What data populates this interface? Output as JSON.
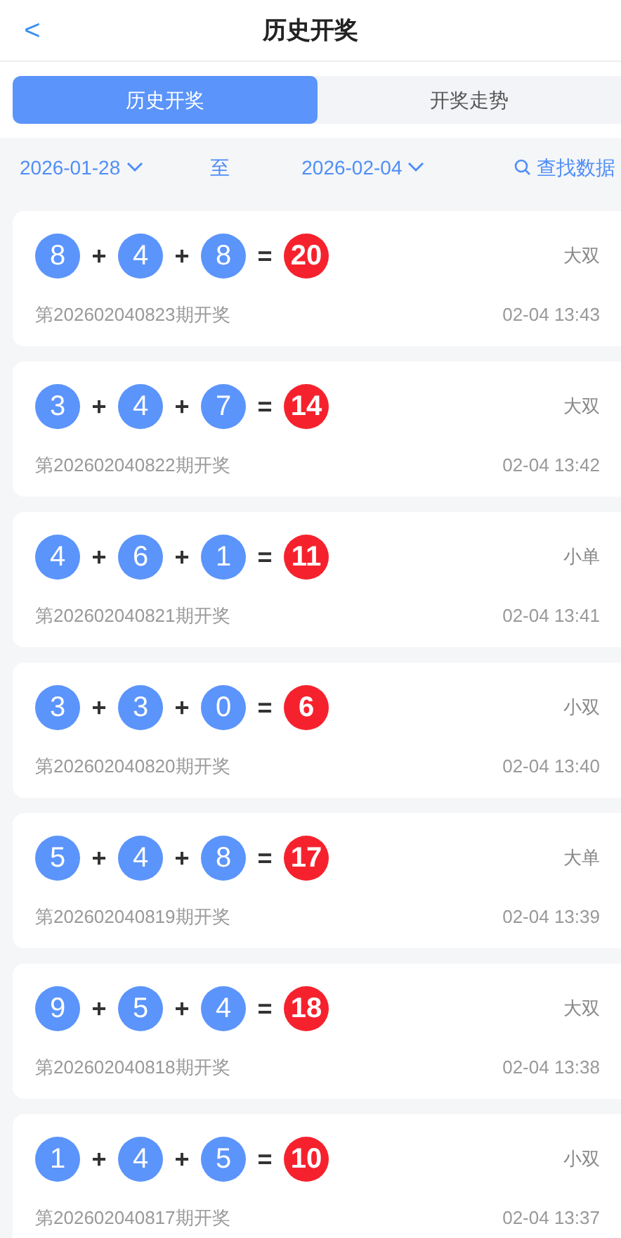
{
  "header": {
    "back": "<",
    "title": "历史开奖"
  },
  "tabs": [
    {
      "label": "历史开奖",
      "selected": true
    },
    {
      "label": "开奖走势",
      "selected": false
    }
  ],
  "filter": {
    "start_date": "2026-01-28",
    "separator": "至",
    "end_date": "2026-02-04",
    "search": "查找数据"
  },
  "records": [
    {
      "expression": [
        {
          "kind": "ball",
          "text": "8"
        },
        {
          "kind": "op",
          "text": "+"
        },
        {
          "kind": "ball",
          "text": "4"
        },
        {
          "kind": "op",
          "text": "+"
        },
        {
          "kind": "ball",
          "text": "8"
        },
        {
          "kind": "op",
          "text": "="
        },
        {
          "kind": "sum",
          "text": "20"
        }
      ],
      "result": "大双",
      "issue": "第202602040823期开奖",
      "time": "02-04 13:43"
    },
    {
      "expression": [
        {
          "kind": "ball",
          "text": "3"
        },
        {
          "kind": "op",
          "text": "+"
        },
        {
          "kind": "ball",
          "text": "4"
        },
        {
          "kind": "op",
          "text": "+"
        },
        {
          "kind": "ball",
          "text": "7"
        },
        {
          "kind": "op",
          "text": "="
        },
        {
          "kind": "sum",
          "text": "14"
        }
      ],
      "result": "大双",
      "issue": "第202602040822期开奖",
      "time": "02-04 13:42"
    },
    {
      "expression": [
        {
          "kind": "ball",
          "text": "4"
        },
        {
          "kind": "op",
          "text": "+"
        },
        {
          "kind": "ball",
          "text": "6"
        },
        {
          "kind": "op",
          "text": "+"
        },
        {
          "kind": "ball",
          "text": "1"
        },
        {
          "kind": "op",
          "text": "="
        },
        {
          "kind": "sum",
          "text": "11"
        }
      ],
      "result": "小单",
      "issue": "第202602040821期开奖",
      "time": "02-04 13:41"
    },
    {
      "expression": [
        {
          "kind": "ball",
          "text": "3"
        },
        {
          "kind": "op",
          "text": "+"
        },
        {
          "kind": "ball",
          "text": "3"
        },
        {
          "kind": "op",
          "text": "+"
        },
        {
          "kind": "ball",
          "text": "0"
        },
        {
          "kind": "op",
          "text": "="
        },
        {
          "kind": "sum",
          "text": "6"
        }
      ],
      "result": "小双",
      "issue": "第202602040820期开奖",
      "time": "02-04 13:40"
    },
    {
      "expression": [
        {
          "kind": "ball",
          "text": "5"
        },
        {
          "kind": "op",
          "text": "+"
        },
        {
          "kind": "ball",
          "text": "4"
        },
        {
          "kind": "op",
          "text": "+"
        },
        {
          "kind": "ball",
          "text": "8"
        },
        {
          "kind": "op",
          "text": "="
        },
        {
          "kind": "sum",
          "text": "17"
        }
      ],
      "result": "大单",
      "issue": "第202602040819期开奖",
      "time": "02-04 13:39"
    },
    {
      "expression": [
        {
          "kind": "ball",
          "text": "9"
        },
        {
          "kind": "op",
          "text": "+"
        },
        {
          "kind": "ball",
          "text": "5"
        },
        {
          "kind": "op",
          "text": "+"
        },
        {
          "kind": "ball",
          "text": "4"
        },
        {
          "kind": "op",
          "text": "="
        },
        {
          "kind": "sum",
          "text": "18"
        }
      ],
      "result": "大双",
      "issue": "第202602040818期开奖",
      "time": "02-04 13:38"
    },
    {
      "expression": [
        {
          "kind": "ball",
          "text": "1"
        },
        {
          "kind": "op",
          "text": "+"
        },
        {
          "kind": "ball",
          "text": "4"
        },
        {
          "kind": "op",
          "text": "+"
        },
        {
          "kind": "ball",
          "text": "5"
        },
        {
          "kind": "op",
          "text": "="
        },
        {
          "kind": "sum",
          "text": "10"
        }
      ],
      "result": "小双",
      "issue": "第202602040817期开奖",
      "time": "02-04 13:37"
    }
  ]
}
